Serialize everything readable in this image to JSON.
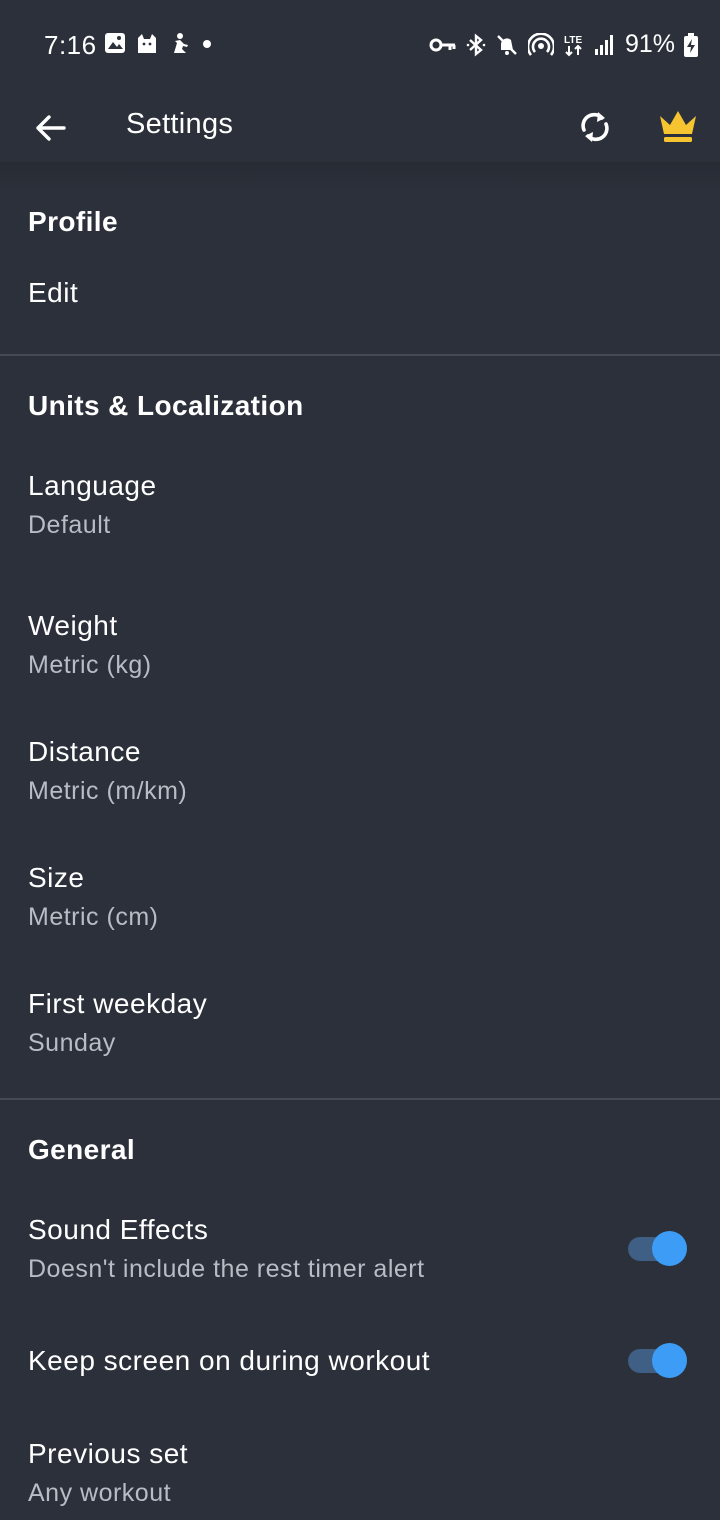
{
  "status_bar": {
    "time": "7:16",
    "battery_percent": "91%",
    "network": "LTE",
    "left_icons": [
      "image-icon",
      "cat-icon",
      "figure-icon",
      "dot-icon"
    ],
    "right_icons": [
      "key-icon",
      "bluetooth-icon",
      "mute-icon",
      "hotspot-icon",
      "lte-icon",
      "signal-icon",
      "battery-charging-icon"
    ]
  },
  "app_bar": {
    "title": "Settings",
    "crown_color": "#f6c431"
  },
  "sections": {
    "profile": {
      "title": "Profile",
      "items": [
        {
          "title": "Edit"
        }
      ]
    },
    "units": {
      "title": "Units & Localization",
      "items": [
        {
          "title": "Language",
          "subtitle": "Default"
        },
        {
          "title": "Weight",
          "subtitle": "Metric (kg)"
        },
        {
          "title": "Distance",
          "subtitle": "Metric (m/km)"
        },
        {
          "title": "Size",
          "subtitle": "Metric (cm)"
        },
        {
          "title": "First weekday",
          "subtitle": "Sunday"
        }
      ]
    },
    "general": {
      "title": "General",
      "items": [
        {
          "title": "Sound Effects",
          "subtitle": "Doesn't include the rest timer alert",
          "toggle": true
        },
        {
          "title": "Keep screen on during workout",
          "toggle": true
        },
        {
          "title": "Previous set",
          "subtitle": "Any workout"
        }
      ]
    }
  },
  "colors": {
    "background": "#2b303a",
    "divider": "#444a55",
    "toggle_on_thumb": "#3d9cf5",
    "toggle_on_track": "#3f5f84",
    "subtitle": "#b7bcc5"
  }
}
